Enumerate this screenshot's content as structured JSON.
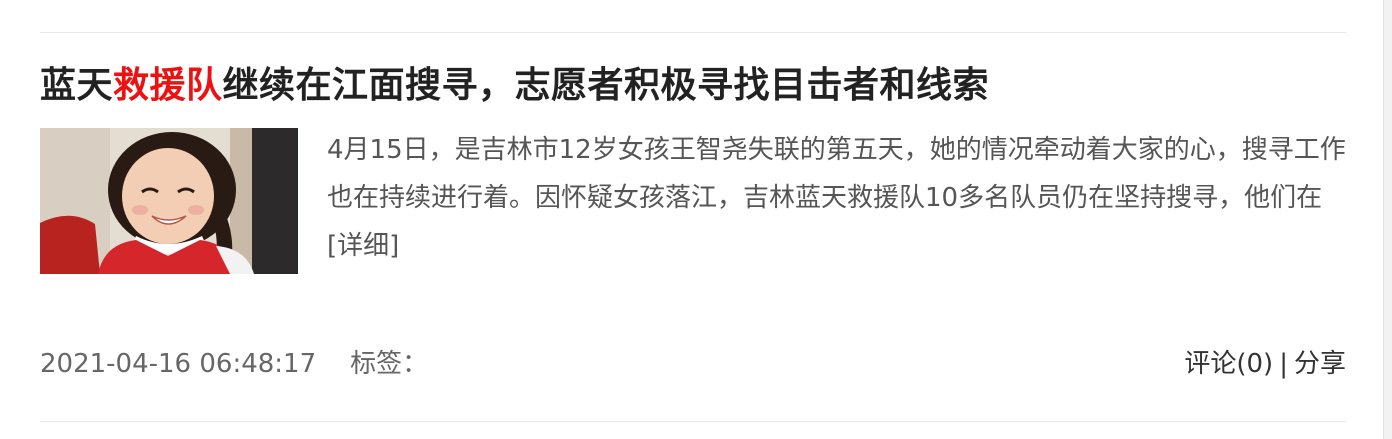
{
  "article": {
    "title_part1": "蓝天",
    "title_highlight": "救援队",
    "title_part2": "继续在江面搜寻，志愿者积极寻找目击者和线索",
    "summary": "4月15日，是吉林市12岁女孩王智尧失联的第五天，她的情况牵动着大家的心，搜寻工作也在持续进行着。因怀疑女孩落江，吉林蓝天救援队10多名队员仍在坚持搜寻，他们在",
    "more_link": "[详细]",
    "date": "2021-04-16 06:48:17",
    "tags_label": "标签：",
    "comment_label": "评论(0)",
    "separator": "|",
    "share_label": "分享"
  },
  "colors": {
    "highlight": "#ee1111",
    "title": "#222222",
    "body_text": "#555555"
  }
}
